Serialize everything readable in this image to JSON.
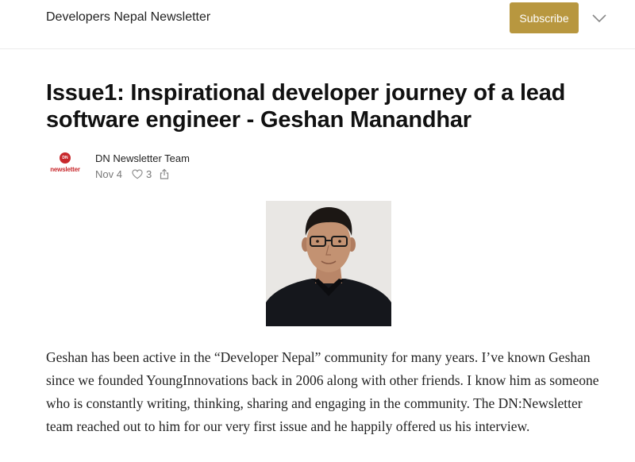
{
  "header": {
    "publication_name": "Developers Nepal Newsletter",
    "subscribe_label": "Subscribe",
    "menu_icon": "chevron-down-icon"
  },
  "post": {
    "title": "Issue1: Inspirational developer journey of a lead software engineer - Geshan Manandhar",
    "author": "DN Newsletter Team",
    "logo_badge": "DN",
    "logo_text": "newsletter",
    "date": "Nov 4",
    "likes": "3",
    "like_icon": "heart-icon",
    "share_icon": "share-icon",
    "photo_icon": "author-photo",
    "body": "Geshan has been active in the “Developer Nepal” community for many years. I’ve known Geshan since we founded YoungInnovations back in 2006 along with other friends. I know him as someone who is constantly writing, thinking, sharing and engaging in the community. The DN:Newsletter team reached out to him for our very first issue and he happily offered us his interview."
  },
  "colors": {
    "accent": "#b8973f",
    "logo_red": "#c8282c"
  }
}
